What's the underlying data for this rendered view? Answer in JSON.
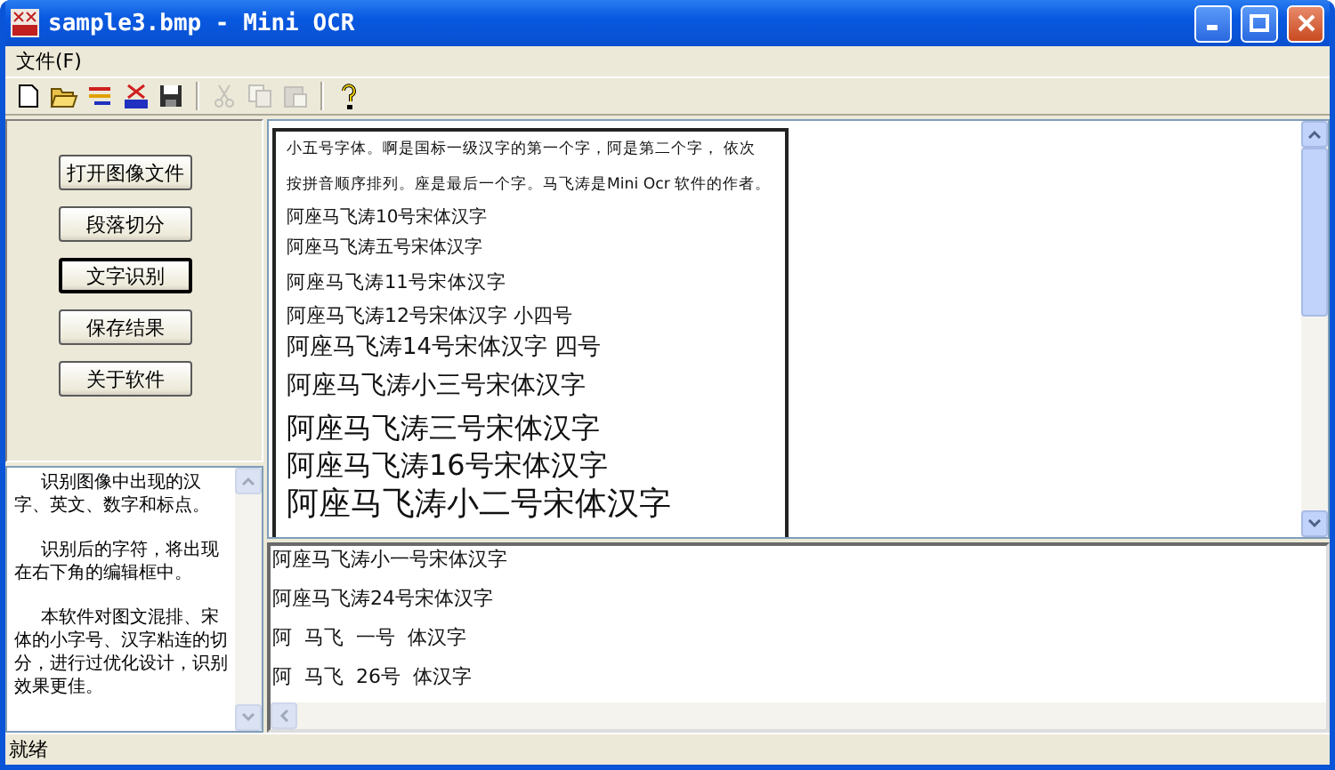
{
  "window": {
    "title": "sample3.bmp - Mini OCR"
  },
  "menu": [
    {
      "label": "文件(F)"
    }
  ],
  "toolbar": [
    {
      "kind": "new",
      "disabled": false
    },
    {
      "kind": "open",
      "disabled": false
    },
    {
      "kind": "segment",
      "disabled": false
    },
    {
      "kind": "ocr",
      "disabled": false
    },
    {
      "kind": "save",
      "disabled": false
    },
    {
      "kind": "separator"
    },
    {
      "kind": "cut",
      "disabled": true
    },
    {
      "kind": "copy",
      "disabled": true
    },
    {
      "kind": "paste",
      "disabled": true
    },
    {
      "kind": "separator"
    },
    {
      "kind": "help",
      "disabled": false
    }
  ],
  "actions": [
    {
      "label": "打开图像文件",
      "focused": false
    },
    {
      "label": "段落切分",
      "focused": false
    },
    {
      "label": "文字识别",
      "focused": true
    },
    {
      "label": "保存结果",
      "focused": false
    },
    {
      "label": "关于软件",
      "focused": false
    }
  ],
  "help_text": {
    "paragraphs": [
      "识别图像中出现的汉字、英文、数字和标点。",
      "识别后的字符，将出现在右下角的编辑框中。",
      "本软件对图文混排、宋体的小字号、汉字粘连的切分，进行过优化设计，识别效果更佳。"
    ]
  },
  "image_view": {
    "lines": [
      "小五号字体。啊是国标一级汉字的第一个字，阿是第二个字，  依次",
      "按拼音顺序排列。座是最后一个字。马飞涛是Mini Ocr 软件的作者。",
      "阿座马飞涛10号宋体汉字",
      "阿座马飞涛五号宋体汉字",
      "阿座马飞涛11号宋体汉字",
      "阿座马飞涛12号宋体汉字 小四号",
      "阿座马飞涛14号宋体汉字  四号",
      "阿座马飞涛小三号宋体汉字",
      "阿座马飞涛三号宋体汉字",
      "阿座马飞涛16号宋体汉字",
      "阿座马飞涛小二号宋体汉字"
    ]
  },
  "result_editor": {
    "lines": [
      "阿座马飞涛小一号宋体汉字",
      "阿座马飞涛24号宋体汉字",
      "阿  马飞  一号  体汉字",
      "阿  马飞  26号  体汉字"
    ]
  },
  "status_bar": {
    "text": "就绪"
  }
}
